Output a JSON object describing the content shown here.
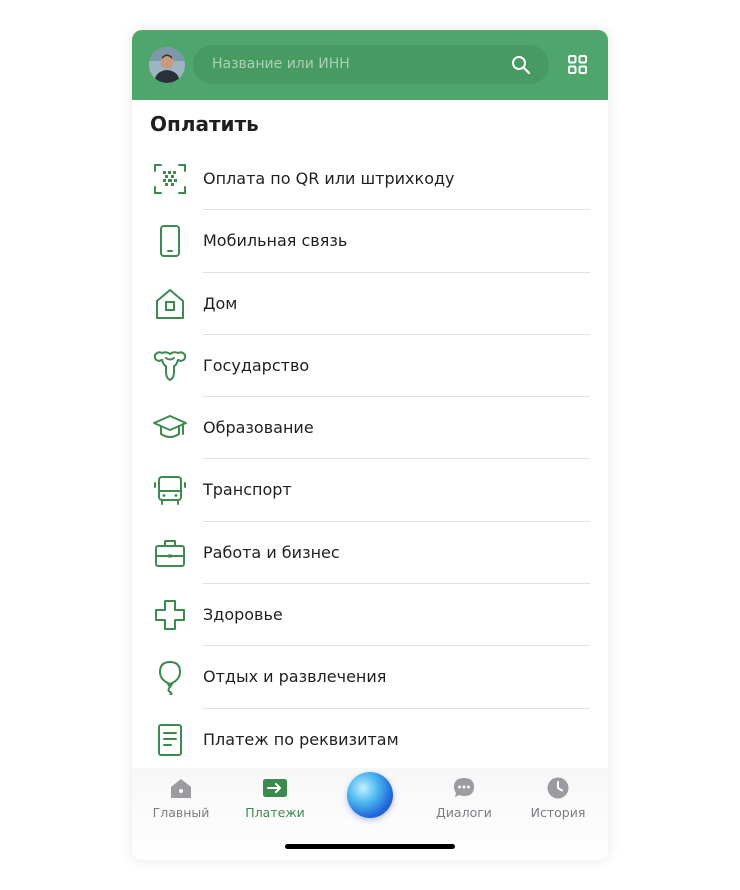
{
  "header": {
    "search_placeholder": "Название или ИНН",
    "avatar_icon": "user-avatar-photo",
    "search_icon": "search-icon",
    "menu_icon": "grid-icon",
    "brand_color": "#4fa66d"
  },
  "section_title": "Оплатить",
  "items": [
    {
      "label": "Оплата по QR или штрихкоду",
      "icon": "qr-scan-icon"
    },
    {
      "label": "Мобильная связь",
      "icon": "smartphone-icon"
    },
    {
      "label": "Дом",
      "icon": "house-icon"
    },
    {
      "label": "Государство",
      "icon": "emblem-icon"
    },
    {
      "label": "Образование",
      "icon": "graduation-cap-icon"
    },
    {
      "label": "Транспорт",
      "icon": "bus-icon"
    },
    {
      "label": "Работа и бизнес",
      "icon": "briefcase-icon"
    },
    {
      "label": "Здоровье",
      "icon": "medical-cross-icon"
    },
    {
      "label": "Отдых и развлечения",
      "icon": "balloon-icon"
    },
    {
      "label": "Платеж по реквизитам",
      "icon": "document-icon"
    }
  ],
  "tabbar": {
    "tabs": [
      {
        "label": "Главный",
        "icon": "home-icon",
        "active": false
      },
      {
        "label": "Платежи",
        "icon": "transfer-arrow-icon",
        "active": true
      },
      {
        "label": "",
        "icon": "assistant-orb-icon",
        "active": false
      },
      {
        "label": "Диалоги",
        "icon": "chat-bubble-icon",
        "active": false
      },
      {
        "label": "История",
        "icon": "clock-icon",
        "active": false
      }
    ],
    "active_color": "#3d8a4f",
    "inactive_color": "#7c7c82"
  }
}
